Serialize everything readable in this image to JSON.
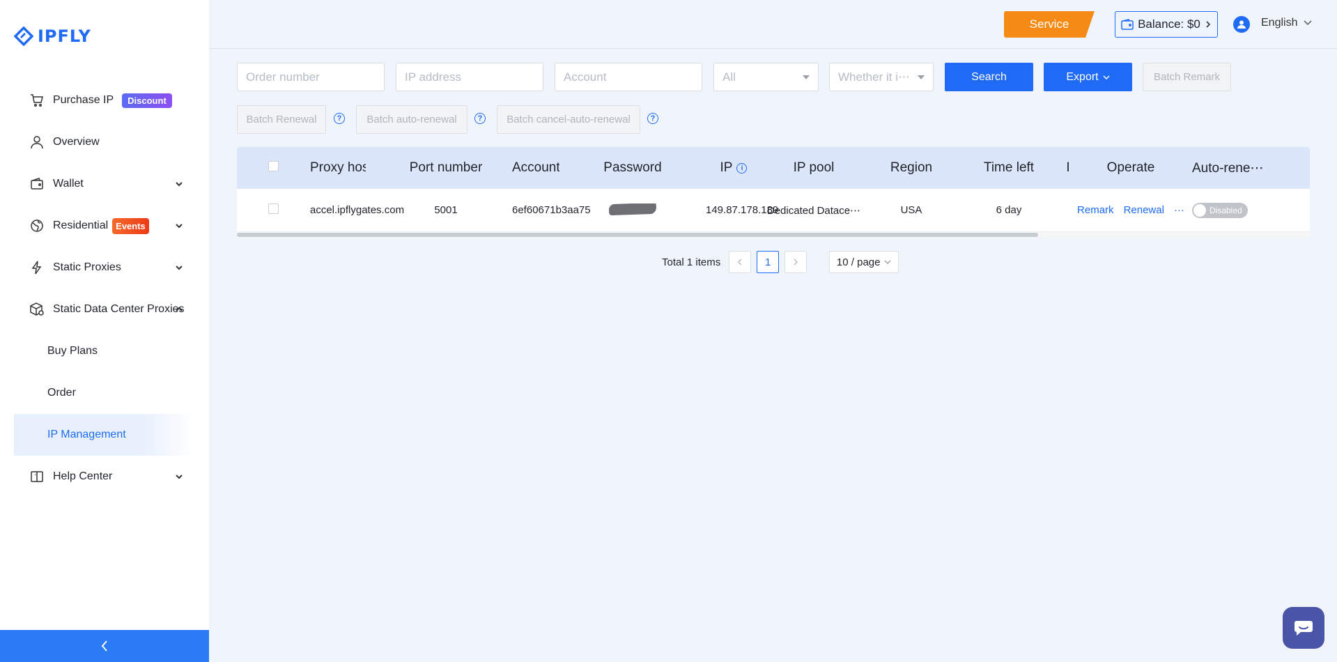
{
  "brand": {
    "name": "IPFLY",
    "color": "#1f6bf5"
  },
  "sidebar": {
    "items": [
      {
        "label": "Purchase IP",
        "icon": "cart-icon",
        "tag": "Discount"
      },
      {
        "label": "Overview",
        "icon": "user-icon"
      },
      {
        "label": "Wallet",
        "icon": "wallet-icon"
      },
      {
        "label": "Residential",
        "icon": "globe-icon",
        "tag": "Events"
      },
      {
        "label": "Static Proxies",
        "icon": "bolt-icon"
      },
      {
        "label": "Static Data Center Proxies",
        "icon": "box-icon",
        "expanded": true,
        "children": [
          {
            "label": "Buy Plans"
          },
          {
            "label": "Order"
          },
          {
            "label": "IP Management",
            "active": true
          }
        ]
      },
      {
        "label": "Help Center",
        "icon": "book-icon"
      }
    ],
    "collapse_icon": "chevron-left-icon"
  },
  "header": {
    "service_label": "Service",
    "balance_label": "Balance: $0",
    "language": "English"
  },
  "filters": {
    "order_number_placeholder": "Order number",
    "ip_address_placeholder": "IP address",
    "account_placeholder": "Account",
    "status_select": "All",
    "whether_select": "Whether it i⋯",
    "search_label": "Search",
    "export_label": "Export",
    "batch_remark_label": "Batch Remark",
    "batch_renewal_label": "Batch Renewal",
    "batch_auto_renewal_label": "Batch auto-renewal",
    "batch_cancel_auto_renewal_label": "Batch cancel-auto-renewal"
  },
  "table": {
    "columns": [
      "Proxy host",
      "Port number",
      "Account",
      "Password",
      "IP",
      "IP pool",
      "Region",
      "Time left",
      "I",
      "Operate",
      "Auto-rene⋯"
    ],
    "rows": [
      {
        "proxy_host": "accel.ipflygates.com",
        "port": "5001",
        "account": "6ef60671b3aa75",
        "ip": "149.87.178.189",
        "ip_pool": "Dedicated Datace⋯",
        "region": "USA",
        "time_left": "6 day",
        "remark": "Remark",
        "renewal": "Renewal",
        "more": "···",
        "auto_renew": "Disabled"
      }
    ]
  },
  "pagination": {
    "total": "Total 1 items",
    "current_page": "1",
    "page_size": "10 / page"
  }
}
